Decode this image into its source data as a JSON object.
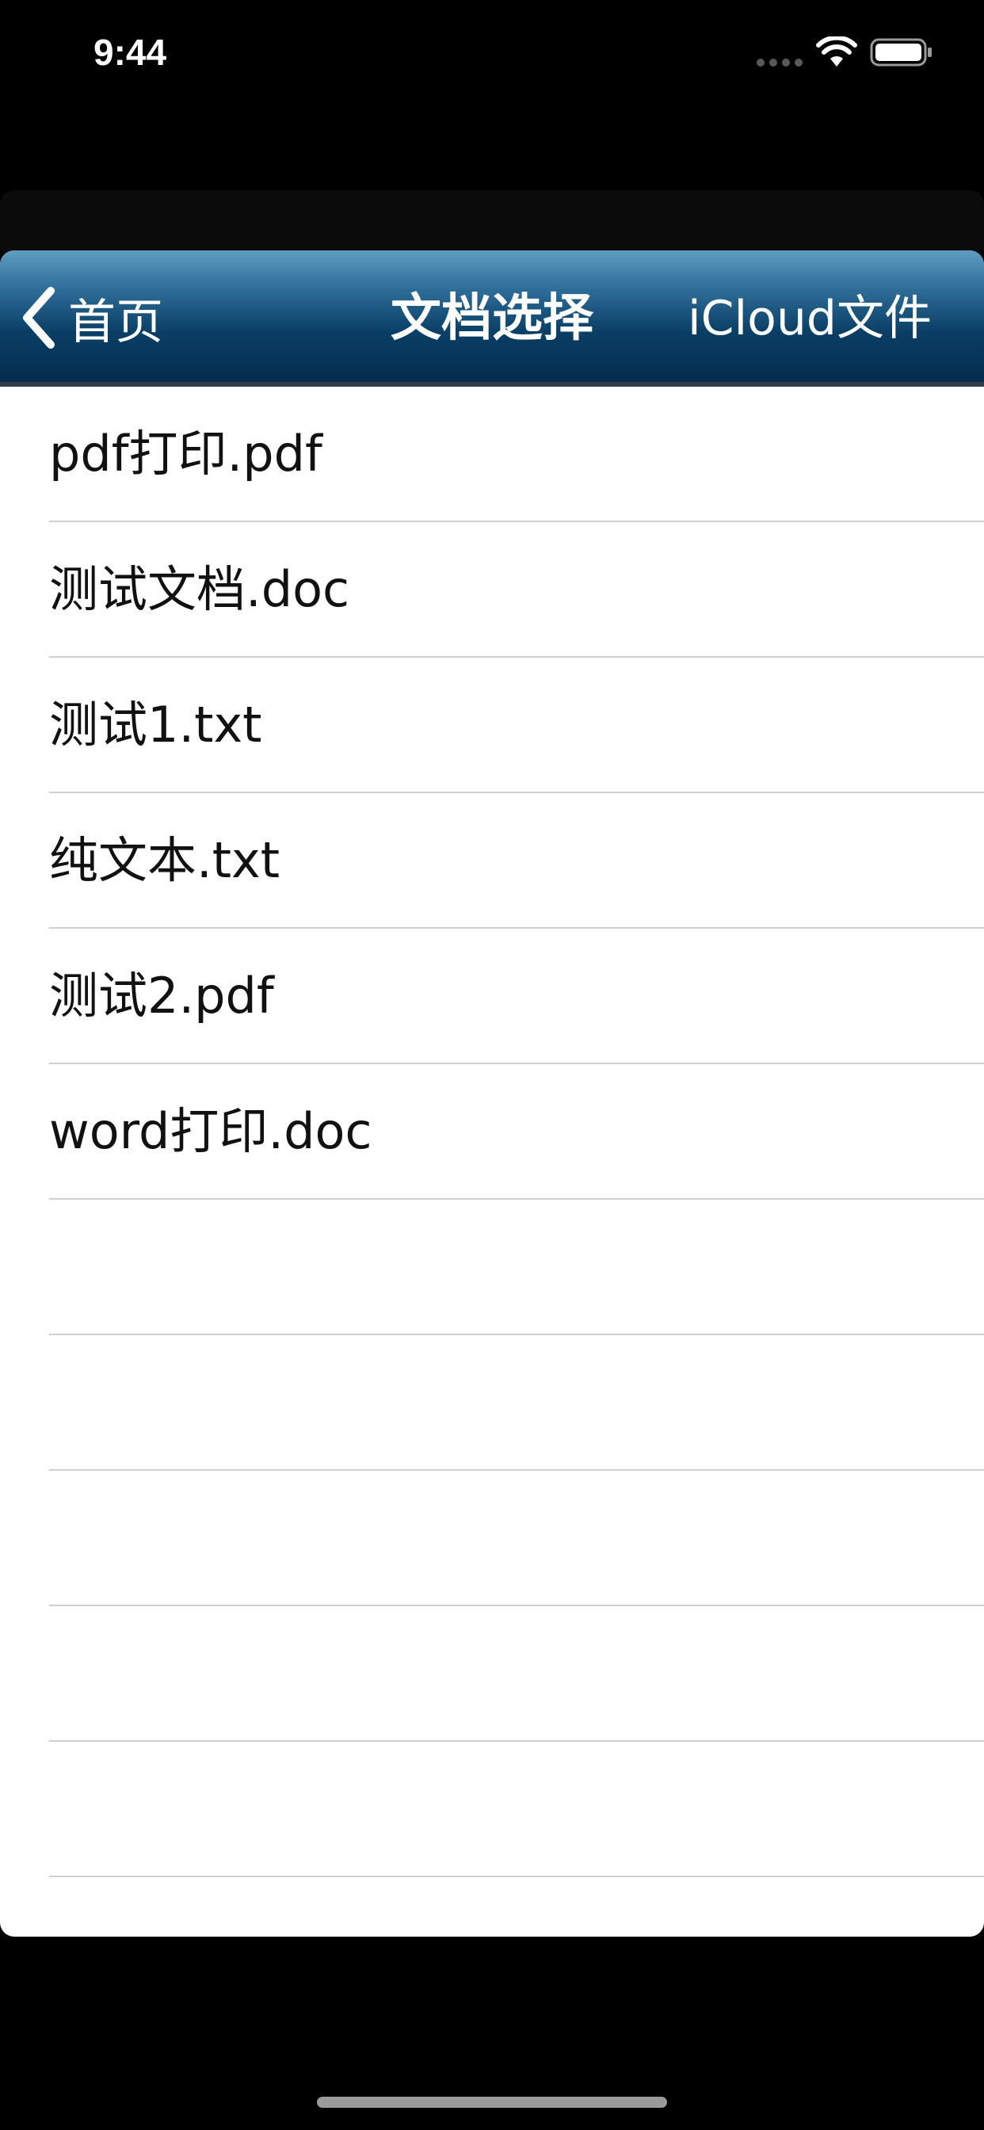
{
  "status_bar": {
    "time": "9:44"
  },
  "nav": {
    "back_label": "首页",
    "title": "文档选择",
    "right_label": "iCloud文件"
  },
  "files": [
    "pdf打印.pdf",
    "测试文档.doc",
    "测试1.txt",
    "纯文本.txt",
    "测试2.pdf",
    "word打印.doc",
    "",
    "",
    "",
    "",
    "",
    ""
  ],
  "icons": {
    "back": "chevron-left-icon",
    "signal": "signal-icon",
    "wifi": "wifi-icon",
    "battery": "battery-icon"
  },
  "colors": {
    "nav_top": "#5f9cc2",
    "nav_bottom": "#042c4d",
    "background": "#000000"
  }
}
